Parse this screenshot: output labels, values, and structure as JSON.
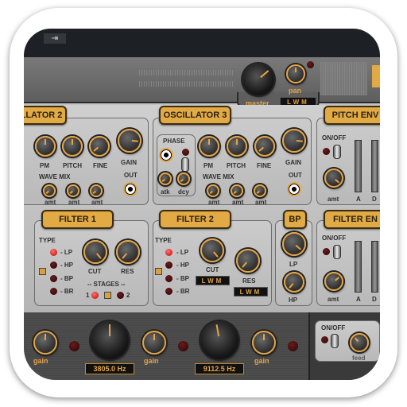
{
  "topbar": {
    "button_icon": "arrow-to-right-icon",
    "button_glyph": "⇥"
  },
  "header": {
    "master_label": "master",
    "pan_label": "pan",
    "lwm": "LWM"
  },
  "osc2": {
    "title": "LLATOR 2",
    "pm": "PM",
    "pitch": "PITCH",
    "fine": "FINE",
    "gain": "GAIN",
    "out": "OUT",
    "wave_mix": "WAVE MIX",
    "amt": "amt"
  },
  "osc3": {
    "title": "OSCILLATOR 3",
    "phase": "PHASE",
    "atk": "atk",
    "dcy": "dcy",
    "pm": "PM",
    "pitch": "PITCH",
    "fine": "FINE",
    "gain": "GAIN",
    "out": "OUT",
    "wave_mix": "WAVE MIX",
    "amt": "amt"
  },
  "pitch_env": {
    "title": "PITCH ENV",
    "onoff": "ON/OFF",
    "amt": "amt",
    "a": "A",
    "d": "D"
  },
  "filter1": {
    "title": "FILTER 1",
    "type": "TYPE",
    "lp": "- LP",
    "hp": "- HP",
    "bp": "- BP",
    "br": "- BR",
    "cut": "CUT",
    "res": "RES",
    "stages": "-- STAGES --",
    "stage1": "1",
    "stage2": "2"
  },
  "filter2": {
    "title": "FILTER 2",
    "type": "TYPE",
    "lp": "- LP",
    "hp": "- HP",
    "bp": "- BP",
    "br": "- BR",
    "cut": "CUT",
    "res": "RES",
    "lwm": "LWM"
  },
  "bp": {
    "title": "BP",
    "lp": "LP",
    "hp": "HP"
  },
  "filter_env": {
    "title": "FILTER EN",
    "onoff": "ON/OFF",
    "amt": "amt",
    "a": "A",
    "d": "D"
  },
  "bottom": {
    "gain": "gain",
    "freq1": "3805.0",
    "freq2": "9112.5",
    "unit": "Hz",
    "onoff": "ON/OFF",
    "feed": "feed"
  },
  "colors": {
    "accent": "#e2aa45",
    "panel": "#c2c2c2",
    "dark": "#1d2024"
  }
}
